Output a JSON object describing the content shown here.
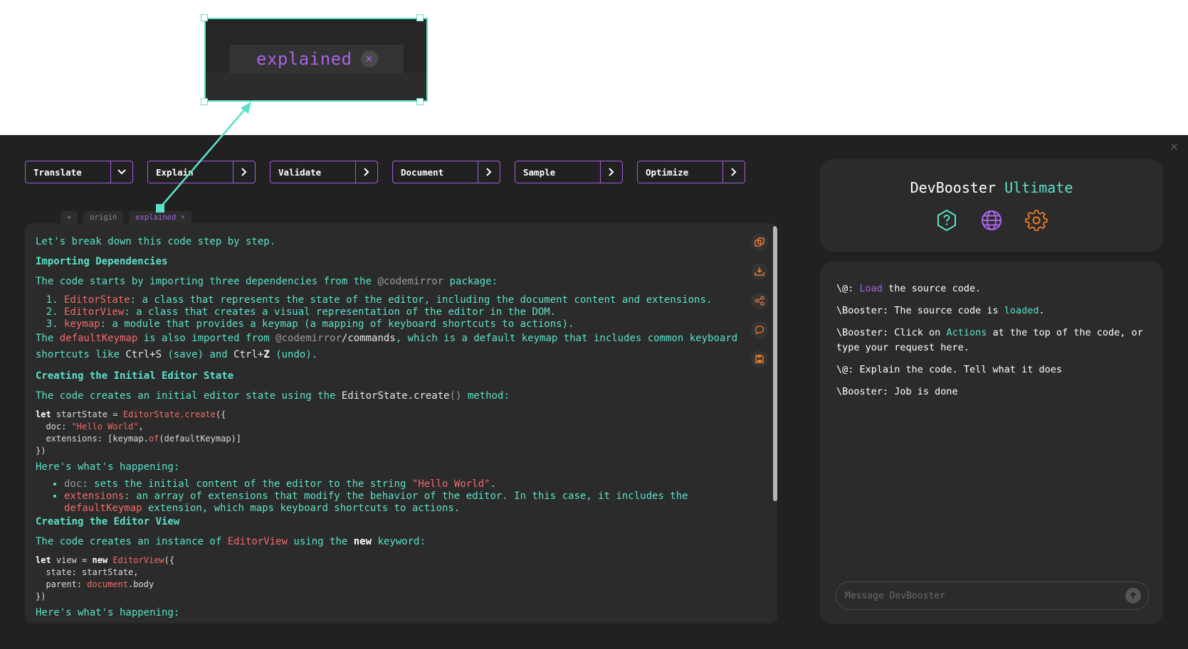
{
  "callout": {
    "tab_label": "explained",
    "close_glyph": "×"
  },
  "colors": {
    "teal": "#5ce1c8",
    "purple": "#a765e0",
    "orange": "#f06b6b",
    "bg": "#212121"
  },
  "window": {
    "close_glyph": "×"
  },
  "actions": [
    {
      "label": "Translate",
      "chevron": "down"
    },
    {
      "label": "Explain",
      "chevron": "right"
    },
    {
      "label": "Validate",
      "chevron": "right"
    },
    {
      "label": "Document",
      "chevron": "right"
    },
    {
      "label": "Sample",
      "chevron": "right"
    },
    {
      "label": "Optimize",
      "chevron": "right"
    }
  ],
  "tabs": {
    "add": "+",
    "origin": "origin",
    "explained": "explained",
    "close": "×"
  },
  "doc": {
    "intro": "Let's break down this code step by step.",
    "h1": "Importing Dependencies",
    "p1_a": "The code starts by importing three dependencies from the ",
    "p1_pkg": "@codemirror",
    "p1_b": " package:",
    "li1_name": "EditorState",
    "li1_text": ": a class that represents the state of the editor, including the document content and extensions.",
    "li2_name": "EditorView",
    "li2_text": ": a class that creates a visual representation of the editor in the DOM.",
    "li3_name": "keymap",
    "li3_text": ": a module that provides a keymap (a mapping of keyboard shortcuts to actions).",
    "p2_a": "The ",
    "p2_name": "defaultKeymap",
    "p2_b": " is also imported from ",
    "p2_pkg": "@codemirror",
    "p2_path": "/commands",
    "p2_c": ", which is a default keymap that includes common keyboard shortcuts like ",
    "p2_k1": "Ctrl+S",
    "p2_d": " (save) and ",
    "p2_k2a": "Ctrl+",
    "p2_k2b": "Z",
    "p2_e": " (undo).",
    "h2": "Creating the Initial Editor State",
    "p3_a": "The code creates an initial editor state using the ",
    "p3_m": "EditorState.create",
    "p3_paren": "()",
    "p3_b": " method:",
    "code1": {
      "l1_kw": "let",
      "l1_var": " startState = ",
      "l1_fn": "EditorState.create",
      "l1_end": "({",
      "l2_key": "  doc: ",
      "l2_str": "\"Hello World\"",
      "l2_end": ",",
      "l3_key": "  extensions: [keymap.",
      "l3_fn": "of",
      "l3_end": "(defaultKeymap)]",
      "l4": "})"
    },
    "h3": "Here's what's happening:",
    "ul1_name": "doc",
    "ul1_a": ": sets the initial content of the editor to the string ",
    "ul1_str": "\"Hello World\"",
    "ul1_b": ".",
    "ul2_name": "extensions",
    "ul2_a": ": an array of extensions that modify the behavior of the editor. In this case, it includes the ",
    "ul2_ref": "defaultKeymap",
    "ul2_b": " extension, which maps keyboard shortcuts to actions.",
    "h4": "Creating the Editor View",
    "p4_a": "The code creates an instance of ",
    "p4_name": "EditorView",
    "p4_b": " using the ",
    "p4_kw": "new",
    "p4_c": " keyword:",
    "code2": {
      "l1_kw": "let",
      "l1_var": " view = ",
      "l1_kw2": "new",
      "l1_sp": " ",
      "l1_fn": "EditorView",
      "l1_end": "({",
      "l2": "  state: startState,",
      "l3_key": "  parent: ",
      "l3_fn": "document",
      "l3_end": ".body",
      "l4": "})"
    },
    "h5": "Here's what's happening:"
  },
  "side_icons": [
    "copy-icon",
    "download-icon",
    "share-icon",
    "comment-icon",
    "save-icon"
  ],
  "brand": {
    "name": "DevBooster",
    "tier": "Ultimate"
  },
  "brand_icons": [
    "help-icon",
    "globe-icon",
    "settings-icon"
  ],
  "chat": {
    "m1_who": "\\@: ",
    "m1_link": "Load",
    "m1_rest": " the source code.",
    "m2_who": "\\Booster: ",
    "m2_a": "The source code is ",
    "m2_link": "loaded",
    "m2_b": ".",
    "m3_who": "\\Booster: ",
    "m3_a": "Click on ",
    "m3_link": "Actions",
    "m3_b": " at the top of the code, or type your request here.",
    "m4_who": "\\@: ",
    "m4_text": "Explain the code. Tell what it does",
    "m5_who": "\\Booster: ",
    "m5_text": "Job is done",
    "input_placeholder": "Message DevBooster"
  }
}
